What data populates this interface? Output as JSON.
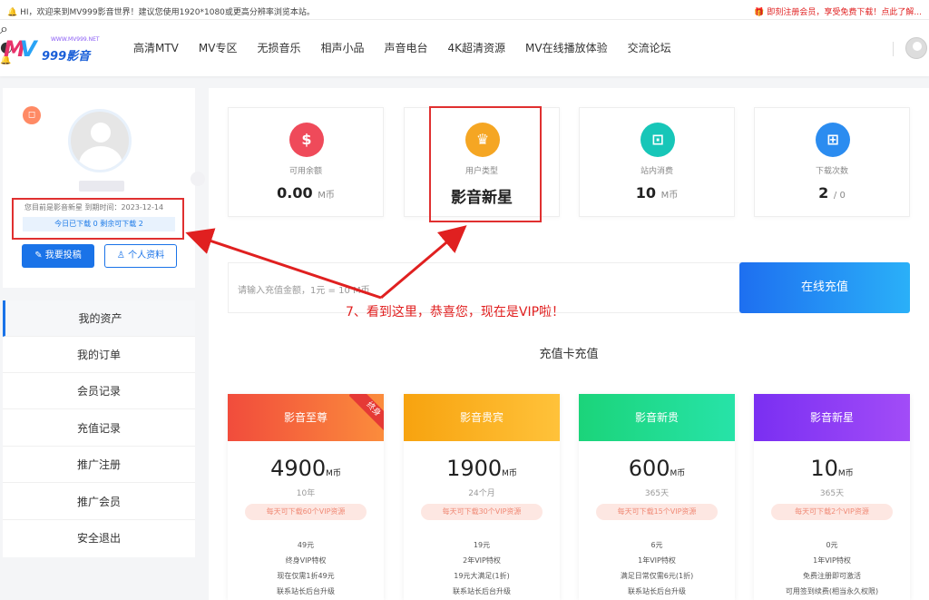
{
  "topbar": {
    "greeting": "🔔 HI，欢迎来到MV999影音世界！建议您使用1920*1080或更高分辨率浏览本站。",
    "promo": "🎁 即刻注册会员，享受免费下载！点此了解..."
  },
  "logo": {
    "mark": "M",
    "mark2": "V",
    "text": "999影音",
    "small": "WWW.MV999.NET"
  },
  "menu": [
    "高清MTV",
    "MV专区",
    "无损音乐",
    "相声小品",
    "声音电台",
    "4K超清资源",
    "MV在线播放体验",
    "交流论坛"
  ],
  "nav_icons": {
    "search": "⌕",
    "theme": "◐",
    "bell": "🔔"
  },
  "profile": {
    "badge": "◻",
    "vip_line": "您目前是影音新星   到期时间：2023-12-14",
    "downloads": "今日已下载 0    剩余可下载 2",
    "submit_label": "我要投稿",
    "profile_label": "个人资料"
  },
  "sidebar": {
    "items": [
      "我的资产",
      "我的订单",
      "会员记录",
      "充值记录",
      "推广注册",
      "推广会员",
      "安全退出"
    ],
    "active_index": 0
  },
  "stats": [
    {
      "label": "可用余额",
      "value": "0.00",
      "unit": "M币",
      "icon": "money-bag-icon",
      "symbol": "$",
      "color": "#ef4a5a"
    },
    {
      "label": "用户类型",
      "value": "影音新星",
      "unit": "",
      "icon": "crown-icon",
      "symbol": "♛",
      "color": "#f5a623"
    },
    {
      "label": "站内消费",
      "value": "10",
      "unit": "M币",
      "icon": "cart-icon",
      "symbol": "⊡",
      "color": "#17c6b8"
    },
    {
      "label": "下载次数",
      "value": "2",
      "unit": "/ 0",
      "icon": "gift-icon",
      "symbol": "⊞",
      "color": "#2b8cf0"
    }
  ],
  "recharge": {
    "placeholder": "请输入充值金额，1元 = 10 M币",
    "button": "在线充值"
  },
  "annotation": "7、看到这里，恭喜您，现在是VIP啦！",
  "cards_title": "充值卡充值",
  "cards": [
    {
      "name": "影音至尊",
      "price": "4900",
      "unit": "M币",
      "term": "10年",
      "daily": "每天可下载60个VIP资源",
      "features": [
        "49元",
        "终身VIP特权",
        "现在仅需1折49元",
        "联系站长后台升级"
      ],
      "ribbon": "终身",
      "color1": "#f14c3c",
      "color2": "#fb8c3c"
    },
    {
      "name": "影音贵宾",
      "price": "1900",
      "unit": "M币",
      "term": "24个月",
      "daily": "每天可下载30个VIP资源",
      "features": [
        "19元",
        "2年VIP特权",
        "19元大满足(1折)",
        "联系站长后台升级"
      ],
      "ribbon": "",
      "color1": "#f7a30f",
      "color2": "#ffc23a"
    },
    {
      "name": "影音新贵",
      "price": "600",
      "unit": "M币",
      "term": "365天",
      "daily": "每天可下载15个VIP资源",
      "features": [
        "6元",
        "1年VIP特权",
        "满足日常仅需6元(1折)",
        "联系站长后台升级"
      ],
      "ribbon": "",
      "color1": "#1bd47a",
      "color2": "#27e3a8"
    },
    {
      "name": "影音新星",
      "price": "10",
      "unit": "M币",
      "term": "365天",
      "daily": "每天可下载2个VIP资源",
      "features": [
        "0元",
        "1年VIP特权",
        "免费注册即可激活",
        "可用签到续费(相当永久权限)"
      ],
      "ribbon": "",
      "color1": "#7a2ff2",
      "color2": "#a24cf7"
    }
  ]
}
